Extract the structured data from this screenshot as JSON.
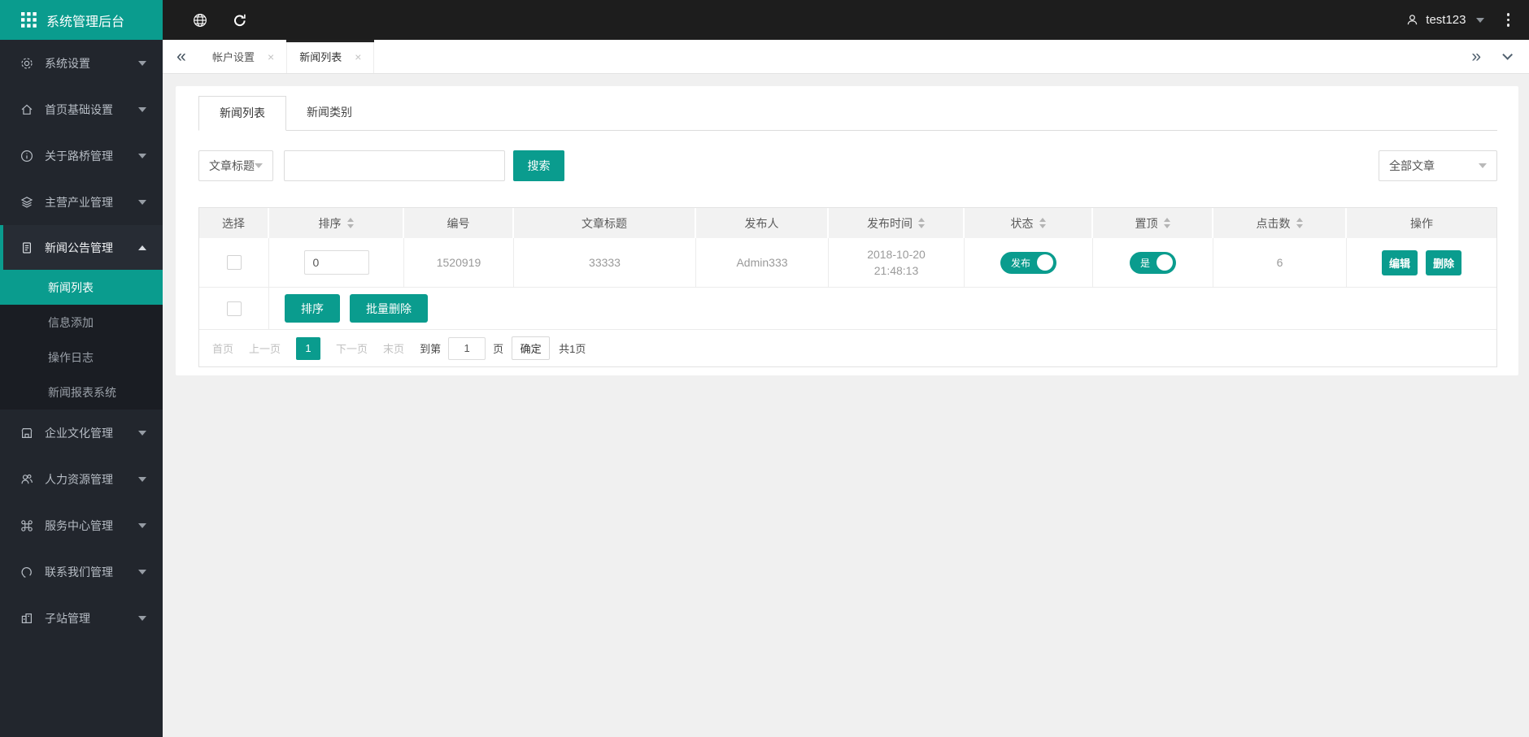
{
  "colors": {
    "accent": "#0a9c8e",
    "topbar": "#1d1d1d",
    "sidebar": "#22262d"
  },
  "brand": {
    "title": "系统管理后台"
  },
  "topbar": {
    "username": "test123"
  },
  "tabbar": {
    "tabs": [
      {
        "label": "帐户设置",
        "close": "×"
      },
      {
        "label": "新闻列表",
        "close": "×"
      }
    ],
    "collapse_icon": "«",
    "expand_icon": "»"
  },
  "sidebar": {
    "items": [
      {
        "label": "系统设置"
      },
      {
        "label": "首页基础设置"
      },
      {
        "label": "关于路桥管理"
      },
      {
        "label": "主营产业管理"
      },
      {
        "label": "新闻公告管理",
        "children": [
          {
            "label": "新闻列表"
          },
          {
            "label": "信息添加"
          },
          {
            "label": "操作日志"
          },
          {
            "label": "新闻报表系统"
          }
        ]
      },
      {
        "label": "企业文化管理"
      },
      {
        "label": "人力资源管理"
      },
      {
        "label": "服务中心管理"
      },
      {
        "label": "联系我们管理"
      },
      {
        "label": "子站管理"
      }
    ]
  },
  "panel": {
    "tabs": [
      {
        "label": "新闻列表"
      },
      {
        "label": "新闻类别"
      }
    ],
    "search": {
      "field": "文章标题",
      "query": "",
      "button": "搜索",
      "filter": "全部文章"
    },
    "table": {
      "headers": [
        {
          "label": "选择"
        },
        {
          "label": "排序"
        },
        {
          "label": "编号"
        },
        {
          "label": "文章标题"
        },
        {
          "label": "发布人"
        },
        {
          "label": "发布时间"
        },
        {
          "label": "状态"
        },
        {
          "label": "置顶"
        },
        {
          "label": "点击数"
        },
        {
          "label": "操作"
        }
      ],
      "row": {
        "sort": "0",
        "id": "1520919",
        "title": "33333",
        "publisher": "Admin333",
        "date": "2018-10-20",
        "time": "21:48:13",
        "status": "发布",
        "pinned": "是",
        "clicks": "6",
        "edit": "编辑",
        "delete": "删除"
      },
      "bulk": {
        "sort": "排序",
        "batch_delete": "批量删除"
      }
    },
    "pagination": {
      "first": "首页",
      "prev": "上一页",
      "page": "1",
      "next": "下一页",
      "last": "末页",
      "goto_prefix": "到第",
      "goto_value": "1",
      "goto_suffix": "页",
      "confirm": "确定",
      "total": "共1页"
    }
  }
}
